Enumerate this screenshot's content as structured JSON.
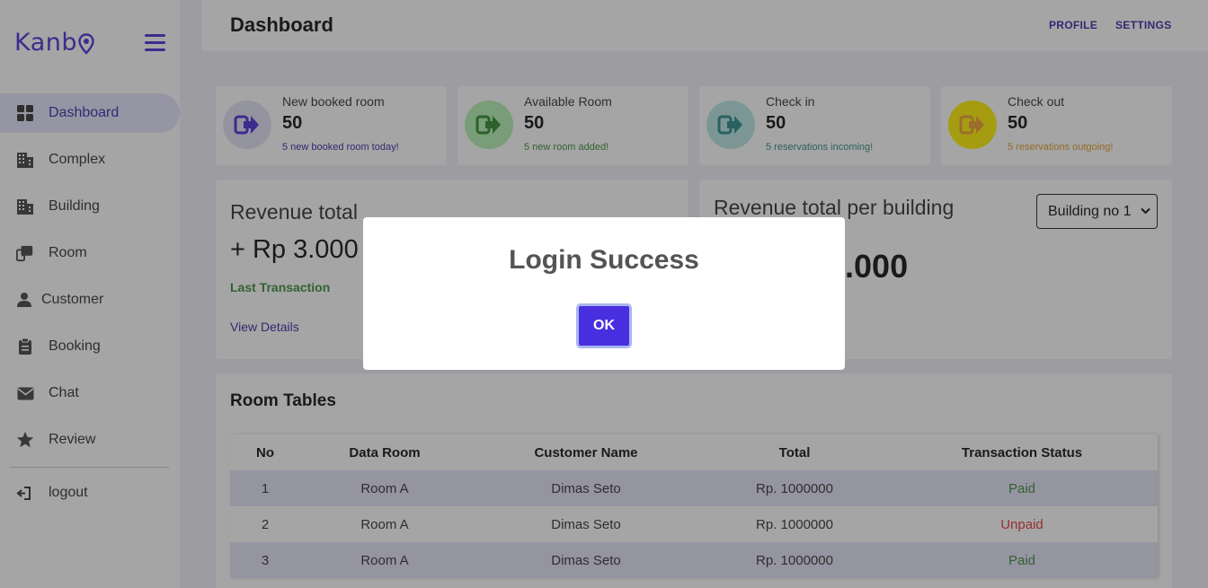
{
  "brand": {
    "name": "Kanb"
  },
  "sidebar": {
    "items": [
      {
        "label": "Dashboard",
        "icon": "grid-icon"
      },
      {
        "label": "Complex",
        "icon": "building-icon"
      },
      {
        "label": "Building",
        "icon": "building-icon"
      },
      {
        "label": "Room",
        "icon": "door-icon"
      },
      {
        "label": "Customer",
        "icon": "user-icon"
      },
      {
        "label": "Booking",
        "icon": "clipboard-icon"
      },
      {
        "label": "Chat",
        "icon": "envelope-icon"
      },
      {
        "label": "Review",
        "icon": "star-icon"
      }
    ],
    "logout_label": "logout"
  },
  "header": {
    "title": "Dashboard",
    "profile_label": "PROFILE",
    "settings_label": "SETTINGS"
  },
  "stats": [
    {
      "label": "New booked room",
      "value": "50",
      "sub": "5 new booked room today!",
      "color": "#3a2aa8",
      "icon_bg": "#e2e0f7",
      "icon_color": "#4a2fd6"
    },
    {
      "label": "Available Room",
      "value": "50",
      "sub": "5 new room added!",
      "color": "#3a8c3a",
      "icon_bg": "#b2f2b2",
      "icon_color": "#2f8a2f"
    },
    {
      "label": "Check in",
      "value": "50",
      "sub": "5 reservations incoming!",
      "color": "#2f8a7a",
      "icon_bg": "#b8e6e6",
      "icon_color": "#2a8a8a"
    },
    {
      "label": "Check out",
      "value": "50",
      "sub": "5 reservations outgoing!",
      "color": "#e39a26",
      "icon_bg": "#fff000",
      "icon_color": "#f0a030"
    }
  ],
  "revenue": {
    "title": "Revenue total",
    "value": "+ Rp 3.000",
    "last_transaction": "Last Transaction",
    "view_details": "View Details"
  },
  "revenue_building": {
    "title": "Revenue total per building",
    "select_value": "Building no 1",
    "value": "0.000"
  },
  "room_tables": {
    "title": "Room Tables",
    "columns": [
      "No",
      "Data Room",
      "Customer Name",
      "Total",
      "Transaction Status"
    ],
    "rows": [
      {
        "no": "1",
        "room": "Room A",
        "customer": "Dimas Seto",
        "total": "Rp. 1000000",
        "status": "Paid"
      },
      {
        "no": "2",
        "room": "Room A",
        "customer": "Dimas Seto",
        "total": "Rp. 1000000",
        "status": "Unpaid"
      },
      {
        "no": "3",
        "room": "Room A",
        "customer": "Dimas Seto",
        "total": "Rp. 1000000",
        "status": "Paid"
      }
    ],
    "status_colors": {
      "Paid": "#3a8c3a",
      "Unpaid": "#e53935"
    }
  },
  "modal": {
    "title": "Login Success",
    "ok_label": "OK"
  }
}
